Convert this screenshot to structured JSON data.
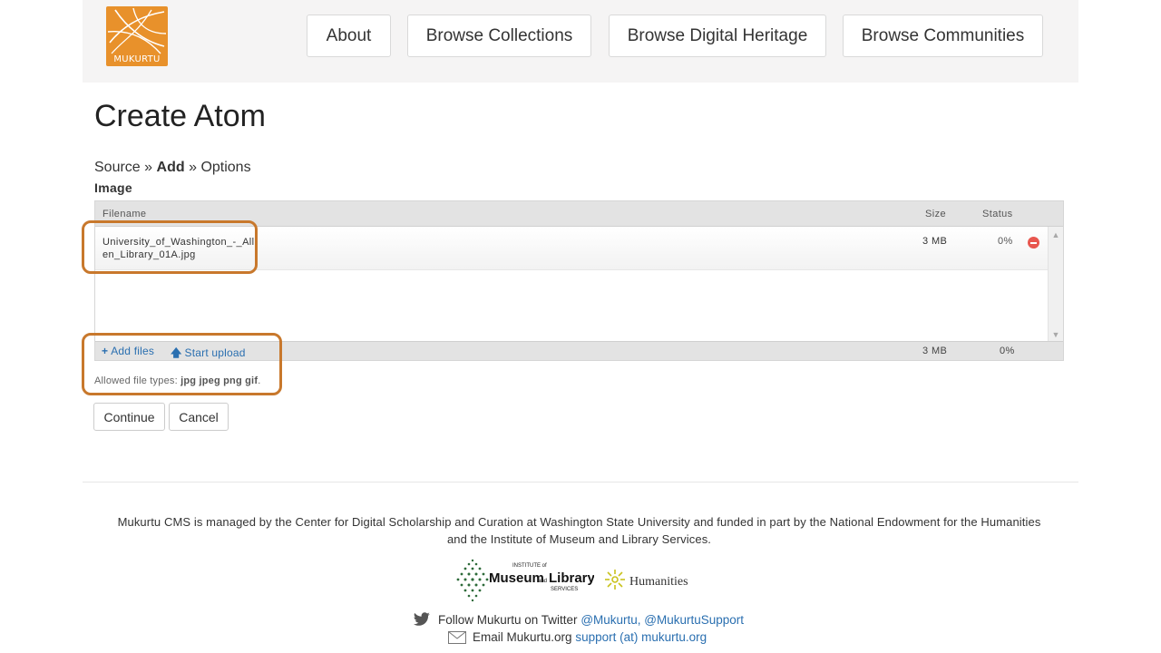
{
  "header": {
    "logo_text": "MUKURTU",
    "nav": [
      {
        "label": "About"
      },
      {
        "label": "Browse Collections"
      },
      {
        "label": "Browse Digital Heritage"
      },
      {
        "label": "Browse Communities"
      }
    ]
  },
  "page": {
    "title": "Create Atom",
    "breadcrumb": {
      "source": "Source",
      "sep": "»",
      "current": "Add",
      "options": "Options"
    },
    "field_label": "Image"
  },
  "uploader": {
    "columns": {
      "filename": "Filename",
      "size": "Size",
      "status": "Status"
    },
    "files": [
      {
        "name": "University_of_Washington_-_Allen_Library_01A.jpg",
        "size": "3 MB",
        "status": "0%"
      }
    ],
    "add_files_label": "Add files",
    "start_upload_label": "Start upload",
    "total_size": "3 MB",
    "total_status": "0%",
    "allowed_prefix": "Allowed file types:",
    "allowed_types": "jpg jpeg png gif"
  },
  "actions": {
    "continue_label": "Continue",
    "cancel_label": "Cancel"
  },
  "footer": {
    "credit_line1": "Mukurtu CMS is managed by the Center for Digital Scholarship and Curation at Washington State University and funded in part by the National Endowment for the Humanities",
    "credit_line2": "and the Institute of Museum and Library Services.",
    "imls_text_top": "INSTITUTE of",
    "imls_text_main": "Museum",
    "imls_text_and": "and",
    "imls_text_lib": "Library",
    "imls_text_services": "SERVICES",
    "neh_text": "Humanities",
    "follow_prefix": "Follow Mukurtu on Twitter",
    "twitter_handles": "@Mukurtu, @MukurtuSupport",
    "email_prefix": "Email Mukurtu.org",
    "email_link": "support (at) mukurtu.org"
  },
  "colors": {
    "accent": "#e8912b",
    "highlight": "#c8782c",
    "link": "#2a6fb0"
  }
}
